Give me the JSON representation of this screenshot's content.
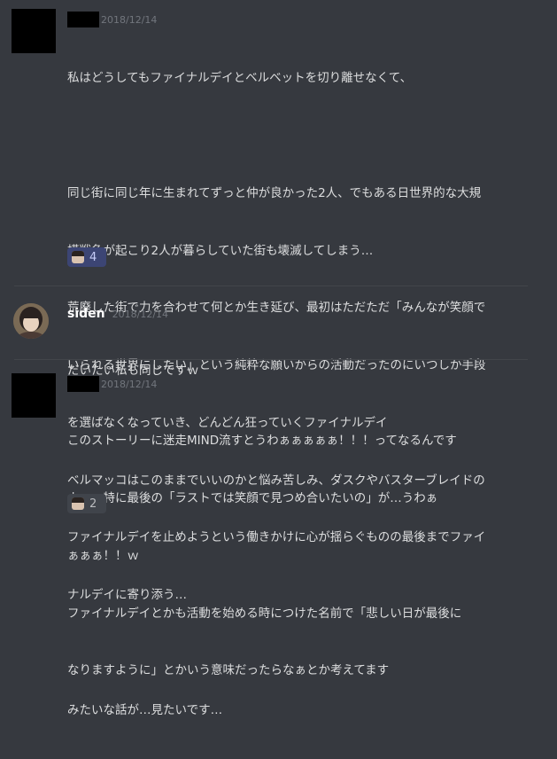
{
  "messages": [
    {
      "author": "",
      "timestamp": "2018/12/14",
      "lines": [
        "私はどうしてもファイナルデイとベルベットを切り離せなくて、",
        "",
        "同じ街に同じ年に生まれてずっと仲が良かった2人、でもある日世界的な大規",
        "模戦争が起こり2人が暮らしていた街も壊滅してしまう…",
        "荒廃した街で力を合わせて何とか生き延び、最初はただただ「みんなが笑顔で",
        "いられる世界にしたい」という純粋な願いからの活動だったのにいつしか手段",
        "を選ばなくなっていき、どんどん狂っていくファイナルデイ",
        "ベルマッコはこのままでいいのかと悩み苦しみ、ダスクやバスターブレイドの",
        "ファイナルデイを止めようという働きかけに心が揺らぐものの最後までファイ",
        "ナルデイに寄り添う…",
        "",
        "みたいな話が…見たいです…"
      ],
      "reaction": {
        "emoji": "character-emoji",
        "count": "4"
      }
    },
    {
      "author": "siden",
      "timestamp": "2018/12/14",
      "lines": [
        "だいたい私も同じですｗ"
      ]
    },
    {
      "author": "",
      "timestamp": "2018/12/14",
      "lines": [
        "このストーリーに迷走MIND流すとうわぁぁぁぁぁ！！！ってなるんです",
        "よ……特に最後の「ラストでは笑顔で見つめ合いたいの」が…うわぁ",
        "ぁぁぁ！！ｗ",
        "ファイナルデイとかも活動を始める時につけた名前で「悲しい日が最後に",
        "なりますように」とかいう意味だったらなぁとか考えてます"
      ],
      "reaction": {
        "emoji": "character-emoji",
        "count": "2"
      }
    }
  ]
}
